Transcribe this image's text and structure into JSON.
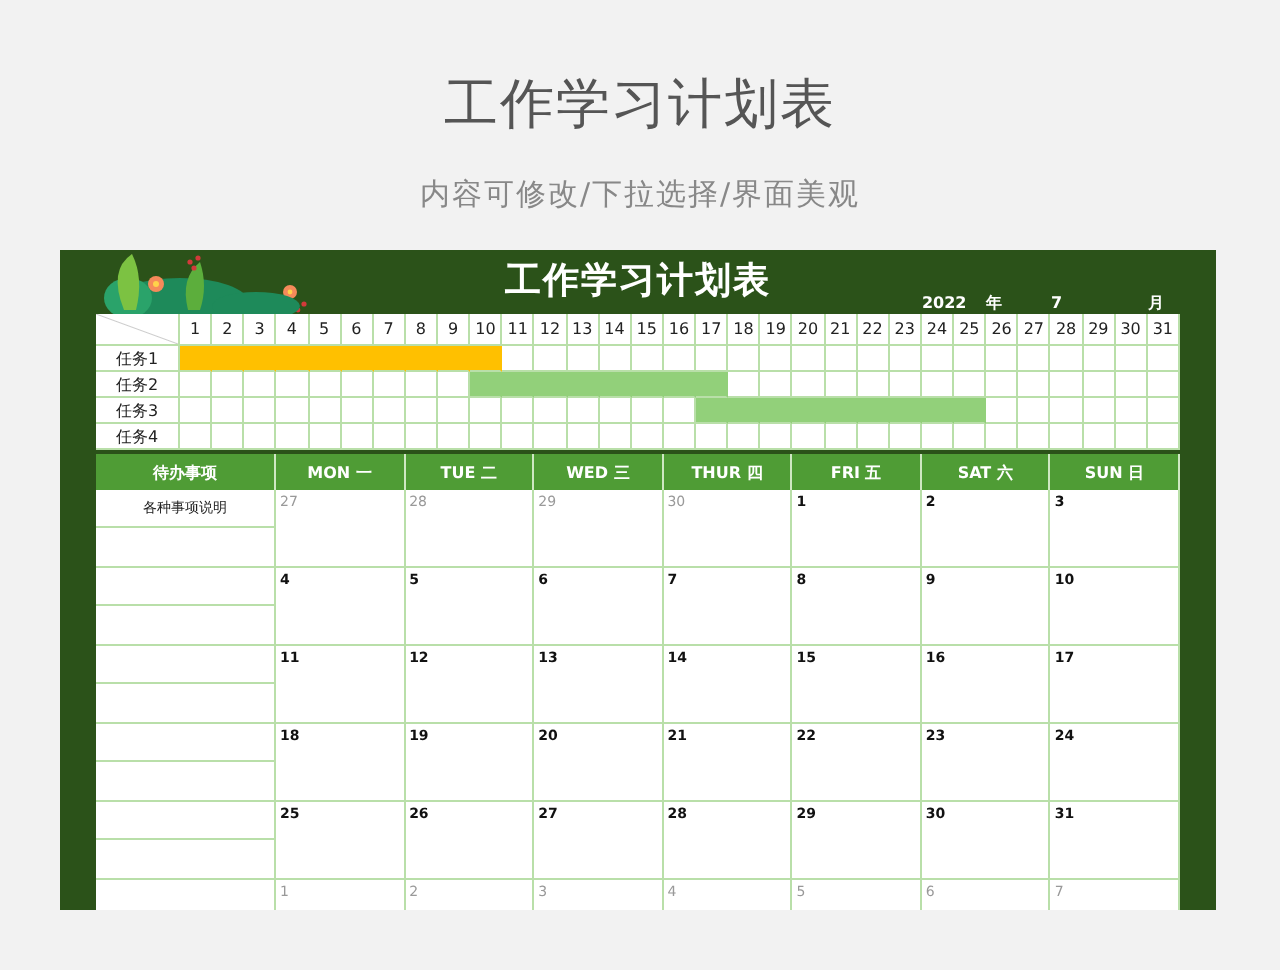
{
  "page": {
    "title": "工作学习计划表",
    "subtitle": "内容可修改/下拉选择/界面美观"
  },
  "sheet": {
    "title": "工作学习计划表",
    "year": "2022",
    "year_unit": "年",
    "month": "7",
    "month_unit": "月"
  },
  "gantt": {
    "days": [
      "1",
      "2",
      "3",
      "4",
      "5",
      "6",
      "7",
      "8",
      "9",
      "10",
      "11",
      "12",
      "13",
      "14",
      "15",
      "16",
      "17",
      "18",
      "19",
      "20",
      "21",
      "22",
      "23",
      "24",
      "25",
      "26",
      "27",
      "28",
      "29",
      "30",
      "31"
    ],
    "tasks": [
      {
        "label": "任务1",
        "color": "#ffc000",
        "filled": [
          true,
          true,
          true,
          true,
          true,
          true,
          true,
          true,
          true,
          true,
          false,
          false,
          false,
          false,
          false,
          false,
          false,
          false,
          false,
          false,
          false,
          false,
          false,
          false,
          false,
          false,
          false,
          false,
          false,
          false,
          false
        ]
      },
      {
        "label": "任务2",
        "color": "#92d07a",
        "filled": [
          false,
          false,
          false,
          false,
          false,
          false,
          false,
          false,
          false,
          true,
          true,
          true,
          true,
          true,
          true,
          true,
          true,
          false,
          false,
          false,
          false,
          false,
          false,
          false,
          false,
          false,
          false,
          false,
          false,
          false,
          false
        ]
      },
      {
        "label": "任务3",
        "color": "#92d07a",
        "filled": [
          false,
          false,
          false,
          false,
          false,
          false,
          false,
          false,
          false,
          false,
          false,
          false,
          false,
          false,
          false,
          false,
          true,
          true,
          true,
          true,
          true,
          true,
          true,
          true,
          true,
          false,
          false,
          false,
          false,
          false,
          false
        ]
      },
      {
        "label": "任务4",
        "filled": [
          false,
          false,
          false,
          false,
          false,
          false,
          false,
          false,
          false,
          false,
          false,
          false,
          false,
          false,
          false,
          false,
          false,
          false,
          false,
          false,
          false,
          false,
          false,
          false,
          false,
          false,
          false,
          false,
          false,
          false,
          false
        ]
      }
    ]
  },
  "calendar": {
    "todo_header": "待办事项",
    "todo_note": "各种事项说明",
    "weekdays": [
      "MON 一",
      "TUE 二",
      "WED 三",
      "THUR 四",
      "FRI 五",
      "SAT 六",
      "SUN 日"
    ],
    "weeks": [
      [
        {
          "date": "27",
          "muted": true
        },
        {
          "date": "28",
          "muted": true
        },
        {
          "date": "29",
          "muted": true
        },
        {
          "date": "30",
          "muted": true
        },
        {
          "date": "1",
          "muted": false
        },
        {
          "date": "2",
          "muted": false
        },
        {
          "date": "3",
          "muted": false
        }
      ],
      [
        {
          "date": "4",
          "muted": false
        },
        {
          "date": "5",
          "muted": false
        },
        {
          "date": "6",
          "muted": false
        },
        {
          "date": "7",
          "muted": false
        },
        {
          "date": "8",
          "muted": false
        },
        {
          "date": "9",
          "muted": false
        },
        {
          "date": "10",
          "muted": false
        }
      ],
      [
        {
          "date": "11",
          "muted": false
        },
        {
          "date": "12",
          "muted": false
        },
        {
          "date": "13",
          "muted": false
        },
        {
          "date": "14",
          "muted": false
        },
        {
          "date": "15",
          "muted": false
        },
        {
          "date": "16",
          "muted": false
        },
        {
          "date": "17",
          "muted": false
        }
      ],
      [
        {
          "date": "18",
          "muted": false
        },
        {
          "date": "19",
          "muted": false
        },
        {
          "date": "20",
          "muted": false
        },
        {
          "date": "21",
          "muted": false
        },
        {
          "date": "22",
          "muted": false
        },
        {
          "date": "23",
          "muted": false
        },
        {
          "date": "24",
          "muted": false
        }
      ],
      [
        {
          "date": "25",
          "muted": false
        },
        {
          "date": "26",
          "muted": false
        },
        {
          "date": "27",
          "muted": false
        },
        {
          "date": "28",
          "muted": false
        },
        {
          "date": "29",
          "muted": false
        },
        {
          "date": "30",
          "muted": false
        },
        {
          "date": "31",
          "muted": false
        }
      ],
      [
        {
          "date": "1",
          "muted": true
        },
        {
          "date": "2",
          "muted": true
        },
        {
          "date": "3",
          "muted": true
        },
        {
          "date": "4",
          "muted": true
        },
        {
          "date": "5",
          "muted": true
        },
        {
          "date": "6",
          "muted": true
        },
        {
          "date": "7",
          "muted": true
        }
      ]
    ]
  }
}
